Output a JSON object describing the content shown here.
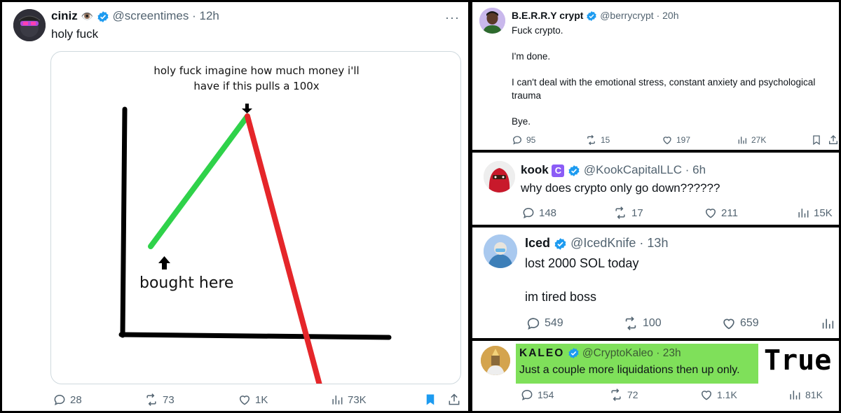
{
  "tweet1": {
    "name": "ciniz",
    "emoji": "👁️",
    "handle": "@screentimes",
    "time": "12h",
    "text": "holy fuck",
    "meme": {
      "caption_line1": "holy fuck imagine how much money i'll",
      "caption_line2": "have if this pulls a 100x",
      "bought_label": "bought here"
    },
    "stats": {
      "replies": "28",
      "reposts": "73",
      "likes": "1K",
      "views": "73K"
    }
  },
  "tweet2": {
    "name": "B.E.R.R.Y crypt",
    "handle": "@berrycrypt",
    "time": "20h",
    "text": "Fuck crypto.\n\nI'm done.\n\nI can't deal with the emotional stress, constant anxiety and psychological trauma\n\nBye.",
    "stats": {
      "replies": "95",
      "reposts": "15",
      "likes": "197",
      "views": "27K"
    }
  },
  "tweet3": {
    "name": "kook",
    "handle": "@KookCapitalLLC",
    "time": "6h",
    "text": "why does crypto only go down??????",
    "stats": {
      "replies": "148",
      "reposts": "17",
      "likes": "211",
      "views": "15K"
    }
  },
  "tweet4": {
    "name": "Iced",
    "handle": "@IcedKnife",
    "time": "13h",
    "text": "lost 2000 SOL today\n\nim tired boss",
    "stats": {
      "replies": "549",
      "reposts": "100",
      "likes": "659"
    }
  },
  "tweet5": {
    "name": "KALEO",
    "handle": "@CryptoKaleo",
    "time": "23h",
    "text": "Just a couple more liquidations then up only.",
    "overlay": "True",
    "stats": {
      "replies": "154",
      "reposts": "72",
      "likes": "1.1K",
      "views": "81K"
    }
  },
  "colors": {
    "verified": "#1d9bf0",
    "bookmark_active": "#1d9bf0",
    "highlight": "#7fe05a",
    "green_line": "#2fd24a",
    "red_line": "#e5262a"
  }
}
